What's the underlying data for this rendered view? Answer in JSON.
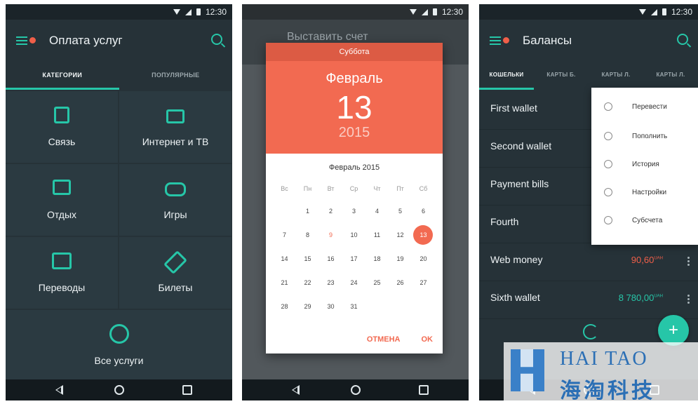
{
  "status": {
    "time": "12:30"
  },
  "screen1": {
    "title": "Оплата услуг",
    "tabs": [
      "КАТЕГОРИИ",
      "ПОПУЛЯРНЫЕ"
    ],
    "categories": [
      {
        "label": "Связь",
        "icon": "phone-icon"
      },
      {
        "label": "Интернет и ТВ",
        "icon": "tv-icon"
      },
      {
        "label": "Отдых",
        "icon": "luggage-icon"
      },
      {
        "label": "Игры",
        "icon": "gamepad-icon"
      },
      {
        "label": "Переводы",
        "icon": "transfer-icon"
      },
      {
        "label": "Билеты",
        "icon": "ticket-icon"
      },
      {
        "label": "Все услуги",
        "icon": "more-icon"
      }
    ]
  },
  "screen2": {
    "background_title": "Выставить счет",
    "picker": {
      "weekday": "Суббота",
      "month": "Февраль",
      "day": "13",
      "year": "2015",
      "month_title": "Февраль 2015",
      "weekday_heads": [
        "Вс",
        "Пн",
        "Вт",
        "Ср",
        "Чт",
        "Пт",
        "Сб"
      ],
      "days": [
        "1",
        "2",
        "3",
        "4",
        "5",
        "6",
        "7",
        "8",
        "9",
        "10",
        "11",
        "12",
        "13",
        "14",
        "15",
        "16",
        "17",
        "18",
        "19",
        "20",
        "21",
        "22",
        "23",
        "24",
        "25",
        "26",
        "27",
        "28",
        "29",
        "30",
        "31"
      ],
      "selected": "13",
      "highlighted": "9",
      "cancel": "ОТМЕНА",
      "ok": "OK"
    }
  },
  "screen3": {
    "title": "Балансы",
    "tabs": [
      "КОШЕЛЬКИ",
      "КАРТЫ Б.",
      "КАРТЫ Л.",
      "КАРТЫ Л."
    ],
    "wallets": [
      {
        "name": "First wallet",
        "amount": ""
      },
      {
        "name": "Second wallet",
        "amount": ""
      },
      {
        "name": "Payment bills",
        "amount": ""
      },
      {
        "name": "Fourth",
        "amount": ""
      },
      {
        "name": "Web money",
        "amount": "90,60",
        "currency": "UAH",
        "color": "#f05f49"
      },
      {
        "name": "Sixth wallet",
        "amount": "8 780,00",
        "currency": "UAH",
        "color": "#26c6a8"
      }
    ],
    "menu": [
      "Перевести",
      "Пополнить",
      "История",
      "Настройки",
      "Субсчета"
    ],
    "fab": "+"
  },
  "watermark": {
    "en": "HAI TAO",
    "cn": "海淘科技"
  },
  "colors": {
    "accent": "#26c6a8",
    "coral": "#f26a51",
    "dark": "#263238"
  }
}
